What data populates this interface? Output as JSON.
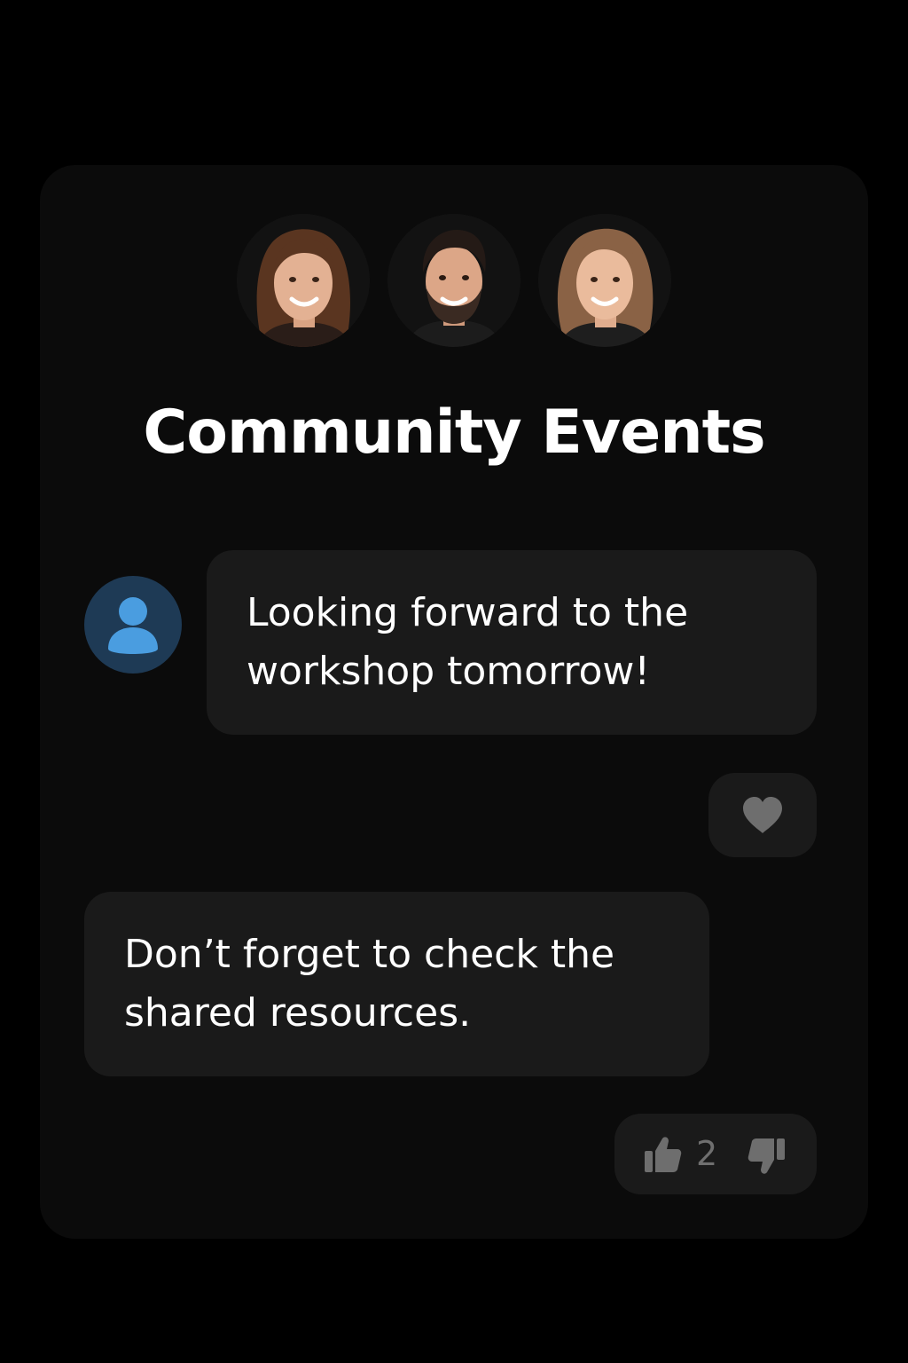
{
  "header": {
    "title": "Community Events",
    "participants": [
      {
        "icon": "woman-portrait-avatar"
      },
      {
        "icon": "man-portrait-avatar"
      },
      {
        "icon": "woman-portrait-avatar"
      }
    ]
  },
  "messages": [
    {
      "author_icon": "default-user-icon",
      "lines": [
        "Looking forward to the",
        "workshop tomorrow!"
      ],
      "reaction_icon": "heart-icon"
    },
    {
      "lines": [
        "Don’t forget to check the",
        "shared resources."
      ],
      "votes": {
        "upvote_icon": "thumbs-up-icon",
        "count": "2",
        "downvote_icon": "thumbs-down-icon"
      }
    }
  ],
  "colors": {
    "background": "#000000",
    "card": "#0b0b0b",
    "bubble": "#1a1a1a",
    "text": "#ffffff",
    "muted": "#6f6f6f",
    "user_avatar_bg": "#1e3a55",
    "user_avatar_fg": "#4a9de0"
  }
}
